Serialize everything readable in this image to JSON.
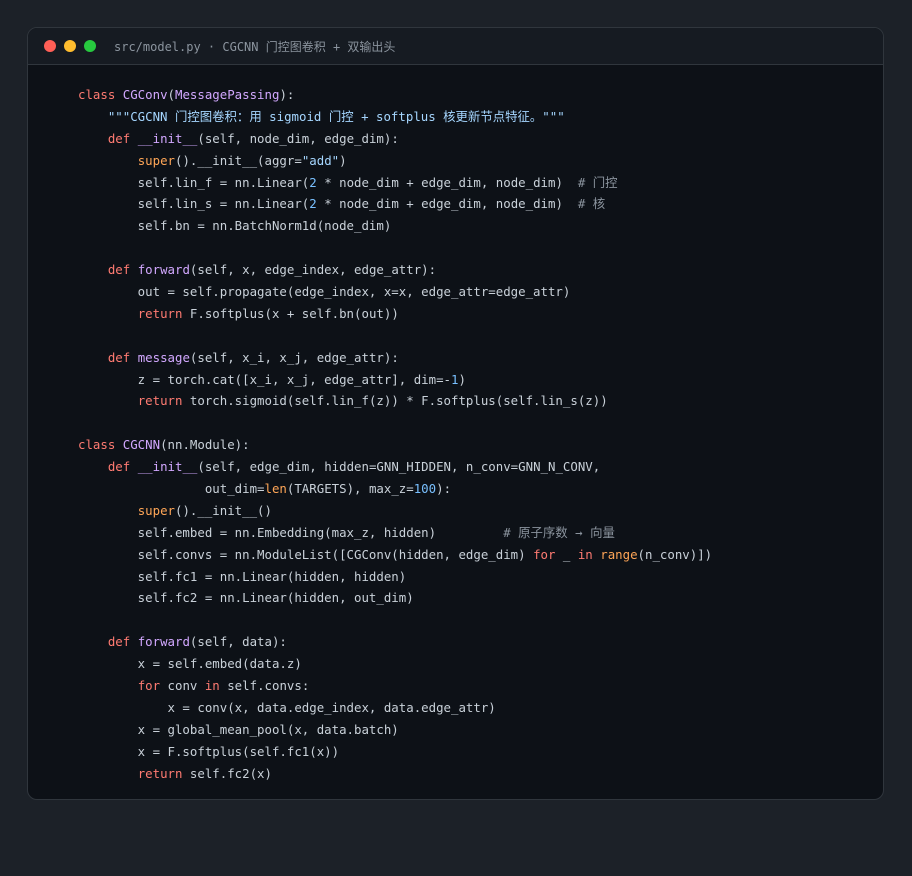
{
  "window": {
    "title": "src/model.py · CGCNN 门控图卷积 + 双输出头"
  },
  "code": {
    "language": "python",
    "lines": [
      [
        [
          "kw",
          "class "
        ],
        [
          "cls",
          "CGConv"
        ],
        [
          "tx",
          "("
        ],
        [
          "cls",
          "MessagePassing"
        ],
        [
          "tx",
          "):"
        ]
      ],
      [
        [
          "tx",
          "    "
        ],
        [
          "str",
          "\"\"\"CGCNN 门控图卷积：用 sigmoid 门控 + softplus 核更新节点特征。\"\"\""
        ]
      ],
      [
        [
          "tx",
          "    "
        ],
        [
          "kw",
          "def "
        ],
        [
          "fn",
          "__init__"
        ],
        [
          "tx",
          "(self, node_dim, edge_dim):"
        ]
      ],
      [
        [
          "tx",
          "        "
        ],
        [
          "bi",
          "super"
        ],
        [
          "tx",
          "().__init__(aggr="
        ],
        [
          "str",
          "\"add\""
        ],
        [
          "tx",
          ")"
        ]
      ],
      [
        [
          "tx",
          "        self.lin_f = nn.Linear("
        ],
        [
          "num",
          "2"
        ],
        [
          "tx",
          " * node_dim + edge_dim, node_dim)  "
        ],
        [
          "cm",
          "# 门控"
        ]
      ],
      [
        [
          "tx",
          "        self.lin_s = nn.Linear("
        ],
        [
          "num",
          "2"
        ],
        [
          "tx",
          " * node_dim + edge_dim, node_dim)  "
        ],
        [
          "cm",
          "# 核"
        ]
      ],
      [
        [
          "tx",
          "        self.bn = nn.BatchNorm1d(node_dim)"
        ]
      ],
      [],
      [
        [
          "tx",
          "    "
        ],
        [
          "kw",
          "def "
        ],
        [
          "fn",
          "forward"
        ],
        [
          "tx",
          "(self, x, edge_index, edge_attr):"
        ]
      ],
      [
        [
          "tx",
          "        out = self.propagate(edge_index, x=x, edge_attr=edge_attr)"
        ]
      ],
      [
        [
          "tx",
          "        "
        ],
        [
          "kw",
          "return "
        ],
        [
          "tx",
          "F.softplus(x + self.bn(out))"
        ]
      ],
      [],
      [
        [
          "tx",
          "    "
        ],
        [
          "kw",
          "def "
        ],
        [
          "fn",
          "message"
        ],
        [
          "tx",
          "(self, x_i, x_j, edge_attr):"
        ]
      ],
      [
        [
          "tx",
          "        z = torch.cat([x_i, x_j, edge_attr], dim=-"
        ],
        [
          "num",
          "1"
        ],
        [
          "tx",
          ")"
        ]
      ],
      [
        [
          "tx",
          "        "
        ],
        [
          "kw",
          "return "
        ],
        [
          "tx",
          "torch.sigmoid(self.lin_f(z)) * F.softplus(self.lin_s(z))"
        ]
      ],
      [],
      [
        [
          "kw",
          "class "
        ],
        [
          "cls",
          "CGCNN"
        ],
        [
          "tx",
          "(nn.Module):"
        ]
      ],
      [
        [
          "tx",
          "    "
        ],
        [
          "kw",
          "def "
        ],
        [
          "fn",
          "__init__"
        ],
        [
          "tx",
          "(self, edge_dim, hidden=GNN_HIDDEN, n_conv=GNN_N_CONV,"
        ]
      ],
      [
        [
          "tx",
          "                 out_dim="
        ],
        [
          "bi",
          "len"
        ],
        [
          "tx",
          "(TARGETS), max_z="
        ],
        [
          "num",
          "100"
        ],
        [
          "tx",
          "):"
        ]
      ],
      [
        [
          "tx",
          "        "
        ],
        [
          "bi",
          "super"
        ],
        [
          "tx",
          "().__init__()"
        ]
      ],
      [
        [
          "tx",
          "        self.embed = nn.Embedding(max_z, hidden)         "
        ],
        [
          "cm",
          "# 原子序数 → 向量"
        ]
      ],
      [
        [
          "tx",
          "        self.convs = nn.ModuleList([CGConv(hidden, edge_dim) "
        ],
        [
          "kw",
          "for"
        ],
        [
          "tx",
          " _ "
        ],
        [
          "kw",
          "in"
        ],
        [
          "tx",
          " "
        ],
        [
          "bi",
          "range"
        ],
        [
          "tx",
          "(n_conv)])"
        ]
      ],
      [
        [
          "tx",
          "        self.fc1 = nn.Linear(hidden, hidden)"
        ]
      ],
      [
        [
          "tx",
          "        self.fc2 = nn.Linear(hidden, out_dim)"
        ]
      ],
      [],
      [
        [
          "tx",
          "    "
        ],
        [
          "kw",
          "def "
        ],
        [
          "fn",
          "forward"
        ],
        [
          "tx",
          "(self, data):"
        ]
      ],
      [
        [
          "tx",
          "        x = self.embed(data.z)"
        ]
      ],
      [
        [
          "tx",
          "        "
        ],
        [
          "kw",
          "for"
        ],
        [
          "tx",
          " conv "
        ],
        [
          "kw",
          "in"
        ],
        [
          "tx",
          " self.convs:"
        ]
      ],
      [
        [
          "tx",
          "            x = conv(x, data.edge_index, data.edge_attr)"
        ]
      ],
      [
        [
          "tx",
          "        x = global_mean_pool(x, data.batch)"
        ]
      ],
      [
        [
          "tx",
          "        x = F.softplus(self.fc1(x))"
        ]
      ],
      [
        [
          "tx",
          "        "
        ],
        [
          "kw",
          "return "
        ],
        [
          "tx",
          "self.fc2(x)"
        ]
      ]
    ]
  }
}
